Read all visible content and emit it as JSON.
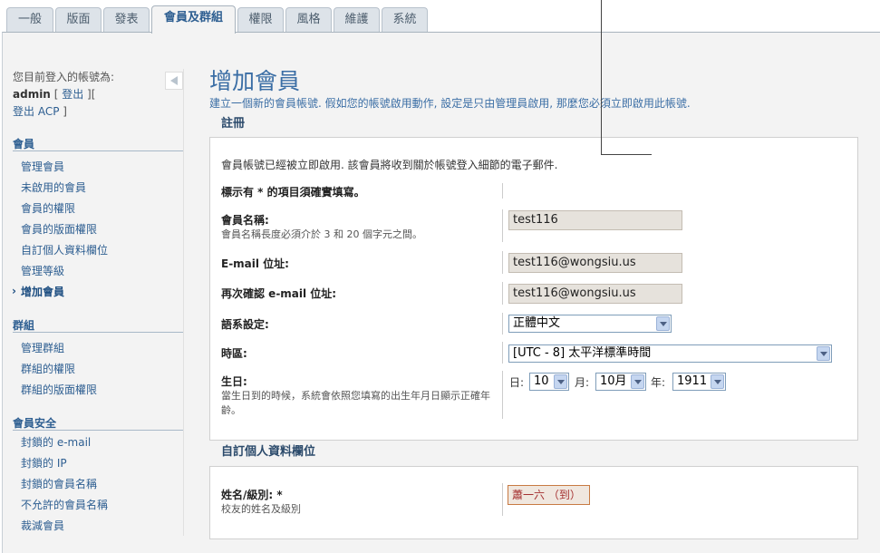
{
  "tabs": [
    "一般",
    "版面",
    "發表",
    "會員及群組",
    "權限",
    "風格",
    "維護",
    "系統"
  ],
  "sidebar": {
    "login_prefix": "您目前登入的帳號為:",
    "username": "admin",
    "logout_link": "登出",
    "acp_link": "登出 ACP",
    "sections": [
      {
        "title": "會員",
        "items": [
          "管理會員",
          "未啟用的會員",
          "會員的權限",
          "會員的版面權限",
          "自訂個人資料欄位",
          "管理等級",
          "增加會員"
        ]
      },
      {
        "title": "群組",
        "items": [
          "管理群組",
          "群組的權限",
          "群組的版面權限"
        ]
      },
      {
        "title": "會員安全",
        "items": [
          "封鎖的 e-mail",
          "封鎖的 IP",
          "封鎖的會員名稱",
          "不允許的會員名稱",
          "裁減會員"
        ]
      }
    ]
  },
  "main": {
    "title": "增加會員",
    "description": "建立一個新的會員帳號. 假如您的帳號啟用動作, 設定是只由管理員啟用, 那麼您必須立即啟用此帳號.",
    "register_legend": "註冊",
    "info_text": "會員帳號已經被立即啟用. 該會員將收到關於帳號登入細節的電子郵件.",
    "required_note": "標示有 * 的項目須確實填寫。",
    "fields": {
      "username_label": "會員名稱:",
      "username_note": "會員名稱長度必須介於 3 和 20 個字元之間。",
      "username_value": "test116",
      "email_label": "E-mail 位址:",
      "email_value": "test116@wongsiu.us",
      "email_confirm_label": "再次確認 e-mail 位址:",
      "email_confirm_value": "test116@wongsiu.us",
      "language_label": "語系設定:",
      "language_value": "正體中文",
      "timezone_label": "時區:",
      "timezone_value": "[UTC - 8] 太平洋標準時間",
      "birthday_label": "生日:",
      "birthday_note": "當生日到的時候，系統會依照您填寫的出生年月日顯示正確年齡。",
      "day_label": "日:",
      "day_value": "10",
      "month_label": "月:",
      "month_value": "10月",
      "year_label": "年:",
      "year_value": "1911"
    },
    "custom_legend": "自訂個人資料欄位",
    "custom_fields": {
      "name_label": "姓名/級別: *",
      "name_note": "校友的姓名及級別",
      "name_value": "蕭一六 （到）"
    }
  }
}
